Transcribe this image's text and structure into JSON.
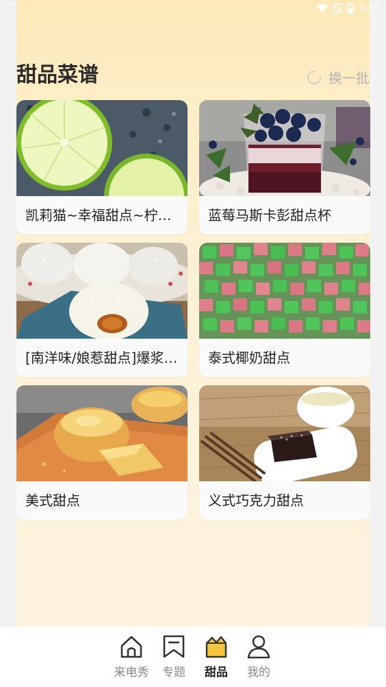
{
  "status": {
    "time": "3:53"
  },
  "header": {
    "title": "甜品菜谱",
    "refresh_label": "换一批"
  },
  "cards": [
    {
      "label": "凯莉猫~幸福甜点~柠檬蛋糕",
      "image": "lime-slices"
    },
    {
      "label": "蓝莓马斯卡彭甜点杯",
      "image": "blueberry-cup"
    },
    {
      "label": "[南洋味/娘惹甜点]爆浆椰丝球",
      "image": "coconut-balls"
    },
    {
      "label": "泰式椰奶甜点",
      "image": "jelly-cubes"
    },
    {
      "label": "美式甜点",
      "image": "egg-tarts"
    },
    {
      "label": "义式巧克力甜点",
      "image": "chocolate-brownie"
    }
  ],
  "nav": {
    "items": [
      {
        "label": "来电秀",
        "icon": "home-icon",
        "active": false
      },
      {
        "label": "专题",
        "icon": "bookmark-icon",
        "active": false
      },
      {
        "label": "甜品",
        "icon": "dessert-icon",
        "active": true
      },
      {
        "label": "我的",
        "icon": "profile-icon",
        "active": false
      }
    ]
  },
  "colors": {
    "accent": "#f5c53c",
    "page_bg": "#fdf1d6",
    "title": "#2b2b2b",
    "muted": "#b5b5b5"
  }
}
